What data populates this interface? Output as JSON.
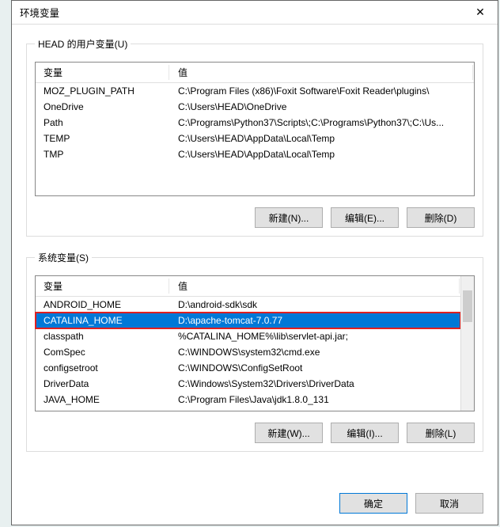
{
  "window": {
    "title": "环境变量",
    "close_glyph": "✕"
  },
  "user_section": {
    "legend": "HEAD 的用户变量(U)",
    "columns": {
      "var": "变量",
      "val": "值"
    },
    "rows": [
      {
        "var": "MOZ_PLUGIN_PATH",
        "val": "C:\\Program Files (x86)\\Foxit Software\\Foxit Reader\\plugins\\"
      },
      {
        "var": "OneDrive",
        "val": "C:\\Users\\HEAD\\OneDrive"
      },
      {
        "var": "Path",
        "val": "C:\\Programs\\Python37\\Scripts\\;C:\\Programs\\Python37\\;C:\\Us..."
      },
      {
        "var": "TEMP",
        "val": "C:\\Users\\HEAD\\AppData\\Local\\Temp"
      },
      {
        "var": "TMP",
        "val": "C:\\Users\\HEAD\\AppData\\Local\\Temp"
      }
    ],
    "buttons": {
      "new": "新建(N)...",
      "edit": "编辑(E)...",
      "delete": "删除(D)"
    }
  },
  "system_section": {
    "legend": "系统变量(S)",
    "columns": {
      "var": "变量",
      "val": "值"
    },
    "rows": [
      {
        "var": "ANDROID_HOME",
        "val": "D:\\android-sdk\\sdk"
      },
      {
        "var": "CATALINA_HOME",
        "val": "D:\\apache-tomcat-7.0.77",
        "selected": true,
        "highlight": true
      },
      {
        "var": "classpath",
        "val": "%CATALINA_HOME%\\lib\\servlet-api.jar;"
      },
      {
        "var": "ComSpec",
        "val": "C:\\WINDOWS\\system32\\cmd.exe"
      },
      {
        "var": "configsetroot",
        "val": "C:\\WINDOWS\\ConfigSetRoot"
      },
      {
        "var": "DriverData",
        "val": "C:\\Windows\\System32\\Drivers\\DriverData"
      },
      {
        "var": "JAVA_HOME",
        "val": "C:\\Program Files\\Java\\jdk1.8.0_131"
      }
    ],
    "buttons": {
      "new": "新建(W)...",
      "edit": "编辑(I)...",
      "delete": "删除(L)"
    }
  },
  "footer": {
    "ok": "确定",
    "cancel": "取消"
  }
}
